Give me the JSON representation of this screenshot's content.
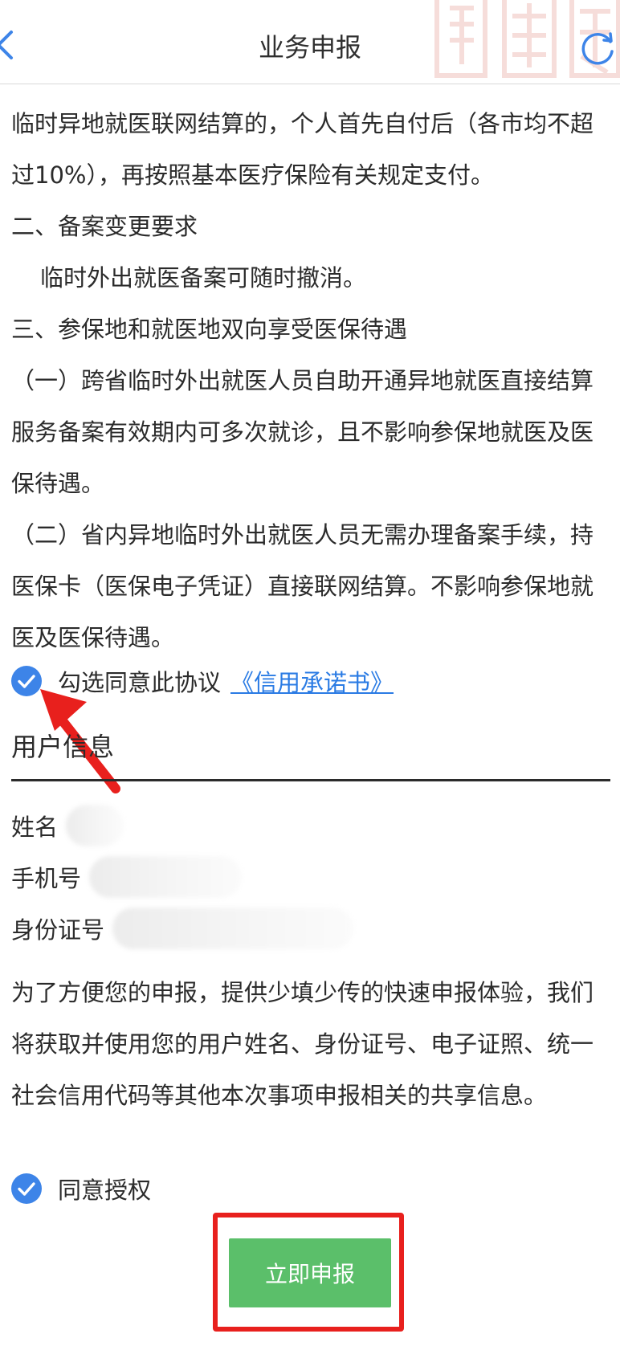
{
  "header": {
    "title": "业务申报"
  },
  "agreement": {
    "paragraphs": [
      "临时异地就医联网结算的，个人首先自付后（各市均不超过10%），再按照基本医疗保险有关规定支付。",
      "二、备案变更要求",
      "临时外出就医备案可随时撤消。",
      "三、参保地和就医地双向享受医保待遇",
      "（一）跨省临时外出就医人员自助开通异地就医直接结算服务备案有效期内可多次就诊，且不影响参保地就医及医保待遇。",
      "（二）省内异地临时外出就医人员无需办理备案手续，持医保卡（医保电子凭证）直接联网结算。不影响参保地就医及医保待遇。"
    ],
    "agree_label": "勾选同意此协议",
    "agree_link": "《信用承诺书》"
  },
  "user_info": {
    "section_title": "用户信息",
    "fields": [
      {
        "label": "姓名"
      },
      {
        "label": "手机号"
      },
      {
        "label": "身份证号"
      }
    ],
    "notice": "为了方便您的申报，提供少填少传的快速申报体验，我们将获取并使用您的用户姓名、身份证号、电子证照、统一社会信用代码等其他本次事项申报相关的共享信息。",
    "authorize_label": "同意授权"
  },
  "submit": {
    "label": "立即申报"
  },
  "colors": {
    "checkbox": "#3d84e8",
    "link": "#2a7be4",
    "submit": "#5bbf6a",
    "highlight": "#e8201d"
  },
  "icons": {
    "back": "chevron-left-icon",
    "refresh": "refresh-icon",
    "check": "check-circle-icon",
    "arrow": "red-arrow-icon"
  }
}
